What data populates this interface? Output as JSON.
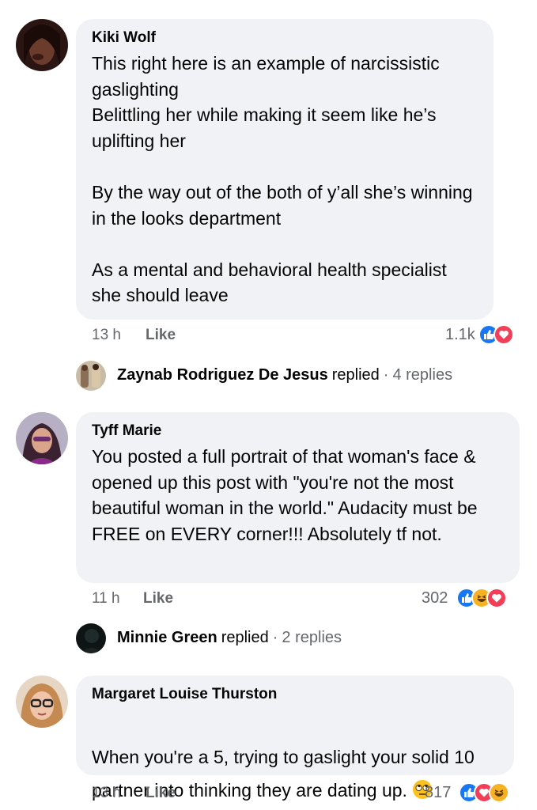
{
  "comments": [
    {
      "author": "Kiki Wolf",
      "text": "This right here is an example of narcissistic gaslighting\nBelittling her while making it seem like he’s uplifting her\n\nBy the way out of the both of y’all she’s winning in the looks department\n\nAs a mental and behavioral health specialist she should leave",
      "time": "13 h",
      "like_label": "Like",
      "reaction_count": "1.1k",
      "reactions": [
        "like-icon",
        "love-icon"
      ],
      "reply": {
        "name": "Zaynab Rodriguez De Jesus",
        "replied": "replied",
        "dot": "·",
        "count": "4 replies"
      }
    },
    {
      "author": "Tyff Marie",
      "text": "You posted a full portrait of that woman's face & opened up this post with \"you're not the most beautiful woman in the world.\" Audacity must be FREE on EVERY corner!!! Absolutely tf not.",
      "time": "11 h",
      "like_label": "Like",
      "reaction_count": "302",
      "reactions": [
        "like-icon",
        "haha-icon",
        "love-icon"
      ],
      "reply": {
        "name": "Minnie Green",
        "replied": "replied",
        "dot": "·",
        "count": "2 replies"
      }
    },
    {
      "author": "Margaret Louise Thurston",
      "text": "When you're a 5, trying to gaslight your solid 10 partner into thinking they are dating up.",
      "emoji": "eye-roll-emoji",
      "time": "13 h",
      "like_label": "Like",
      "reaction_count": "817",
      "reactions": [
        "like-icon",
        "love-icon",
        "haha-icon"
      ]
    }
  ],
  "colors": {
    "bubble": "#f0f2f5",
    "meta": "#65676b",
    "like": "#1877f2",
    "love": "#f33e58",
    "haha": "#f7b125"
  }
}
